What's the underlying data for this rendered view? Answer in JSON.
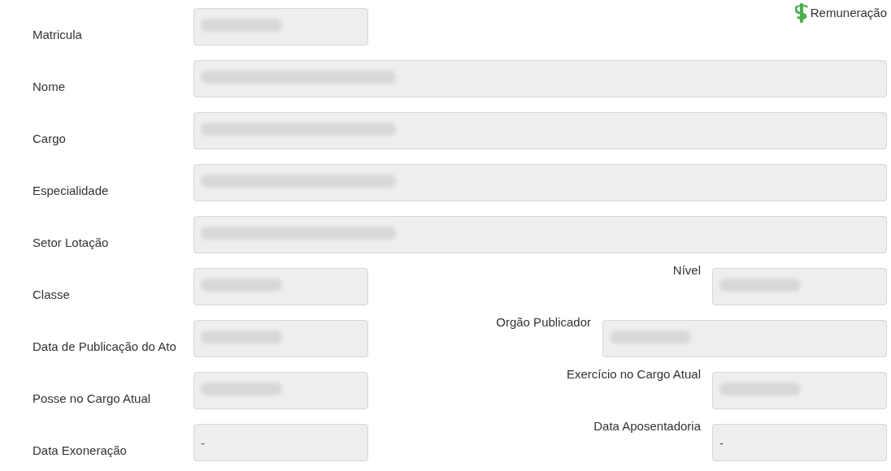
{
  "link": {
    "label": "Remuneração"
  },
  "rows": [
    {
      "kind": "split",
      "left": {
        "label": "Matricula",
        "redacted": true
      }
    },
    {
      "kind": "wide",
      "left": {
        "label": "Nome",
        "redacted": true
      }
    },
    {
      "kind": "wide",
      "left": {
        "label": "Cargo",
        "redacted": true
      }
    },
    {
      "kind": "wide",
      "left": {
        "label": "Especialidade",
        "redacted": true
      }
    },
    {
      "kind": "wide",
      "left": {
        "label": "Setor Lotação",
        "redacted": true
      }
    },
    {
      "kind": "split",
      "left": {
        "label": "Classe",
        "redacted": true
      },
      "right": {
        "label": "Nível",
        "redacted": true,
        "kind": "normal"
      }
    },
    {
      "kind": "split",
      "left": {
        "label": "Data de Publicação do Ato",
        "redacted": true
      },
      "right": {
        "label": "Orgão Publicador",
        "redacted": true,
        "kind": "wide"
      }
    },
    {
      "kind": "split",
      "left": {
        "label": "Posse no Cargo Atual",
        "redacted": true
      },
      "right": {
        "label": "Exercício no Cargo Atual",
        "redacted": true,
        "kind": "normal"
      }
    },
    {
      "kind": "split",
      "left": {
        "label": "Data Exoneração",
        "value": "-",
        "redacted": false
      },
      "right": {
        "label": "Data Aposentadoria",
        "value": "-",
        "redacted": false,
        "kind": "normal"
      }
    }
  ]
}
